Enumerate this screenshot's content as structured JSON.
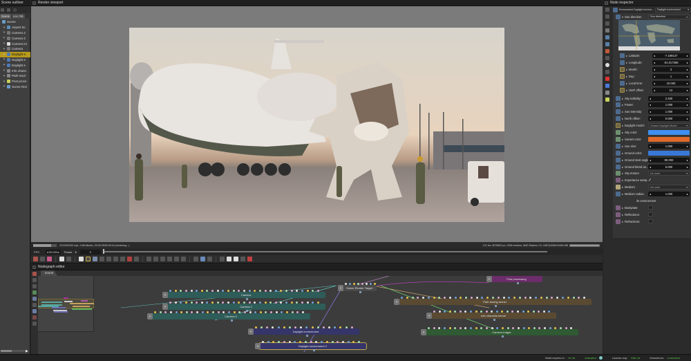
{
  "outliner": {
    "title": "Scene outliner",
    "tabs": [
      "Scene",
      "Live DB"
    ],
    "root": "Scene",
    "items": [
      {
        "label": "Airport Sc",
        "icon": "mesh-icon",
        "color": "#5d8fb8",
        "selected": false
      },
      {
        "label": "Camera 2",
        "icon": "camera-icon",
        "color": "#777777",
        "selected": false
      },
      {
        "label": "Camera 3",
        "icon": "camera-icon",
        "color": "#777777",
        "selected": false
      },
      {
        "label": "Camera im",
        "icon": "imager-icon",
        "color": "#dddddd",
        "selected": false
      },
      {
        "label": "Camera",
        "icon": "camera-icon",
        "color": "#777777",
        "selected": false
      },
      {
        "label": "Daylight e",
        "icon": "environment-icon",
        "color": "#4d7bb8",
        "selected": true
      },
      {
        "label": "Daylight e",
        "icon": "environment-icon",
        "color": "#4d7bb8",
        "selected": false
      },
      {
        "label": "Daylight e",
        "icon": "environment-icon",
        "color": "#4d7bb8",
        "selected": false
      },
      {
        "label": "Info chann",
        "icon": "kernel-icon",
        "color": "#888888",
        "selected": false
      },
      {
        "label": "Path tracir",
        "icon": "kernel-icon",
        "color": "#888888",
        "selected": false
      },
      {
        "label": "Post proce",
        "icon": "postprocess-icon",
        "color": "#c8d25a",
        "selected": false
      },
      {
        "label": "Scene Ren",
        "icon": "render-target-icon",
        "color": "#6a9cc8",
        "selected": false
      }
    ]
  },
  "viewport": {
    "title": "Render viewport",
    "status_left": "231/263/300 s/px, 4.88 Ms/sec, 00:00:39/00:00:44 (rendering...)",
    "status_right": "121 tex, 8078692 pri, 2096 meshes, AMD Radeon VII, 1867|16384/16384 MB",
    "render_progress": 0.77,
    "fps_label": "FPS",
    "fps_value": "30.000",
    "frame_mode": "Frame",
    "frame_value": "0",
    "timeline_end": "1",
    "image_alt": "Rendered airport scene with a whale-shaped aircraft, a large white mech and ground crew at sunset"
  },
  "render_toolbar": [
    "reload-icon",
    "scatter-icon",
    "color-cube-icon",
    "stop-icon",
    "restart-icon",
    "pause-icon",
    "start-icon",
    "region-render-icon",
    "pick-icon",
    "color-pick-icon",
    "material-pick-icon",
    "object-pick-icon",
    "camera-pick-icon",
    "focus-pick-icon",
    "white-balance-icon",
    "render-layer-icon",
    "clay-icon",
    "subsample-icon",
    "decal-icon",
    "viewport-lock-icon",
    "gizmo-icon",
    "copy-icon",
    "lock-icon",
    "zoom-region-icon",
    "move-icon",
    "rotate-icon",
    "scale-icon",
    "axis-icon"
  ],
  "nodegraph": {
    "title": "Nodegraph editor",
    "tab": "Scene",
    "nodes": [
      {
        "label": "Camera",
        "style": "teal"
      },
      {
        "label": "Camera 2",
        "style": "teal"
      },
      {
        "label": "Camera 3",
        "style": "teal"
      },
      {
        "label": "Scene Render Target",
        "style": "grey"
      },
      {
        "label": "Post processing",
        "style": "purple"
      },
      {
        "label": "Path tracing kernel",
        "style": "brown"
      },
      {
        "label": "Info channels kernel",
        "style": "brown"
      },
      {
        "label": "Daylight environment",
        "style": "navy"
      },
      {
        "label": "Daylight environment 2",
        "style": "navy"
      },
      {
        "label": "Camera imager",
        "style": "green"
      }
    ],
    "pin_colors": [
      "#6fa3d6",
      "#d9a7d0",
      "#e8c24a",
      "#e6e6e6",
      "#a8dcb0"
    ]
  },
  "inspector": {
    "title": "Node inspector",
    "node_type": "Environment Daylight environ...",
    "node_select": "Daylight environment",
    "sun_direction_label": "Sun direction",
    "sun_direction_select": "Sun direction",
    "params": [
      {
        "label": "Latitude:",
        "value": "-7.168137",
        "toggle": "blue",
        "kind": "number"
      },
      {
        "label": "Longitude:",
        "value": "-61.017266",
        "toggle": "blue",
        "kind": "number"
      },
      {
        "label": "Month:",
        "value": "3",
        "toggle": "gold",
        "kind": "number"
      },
      {
        "label": "Day:",
        "value": "1",
        "toggle": "gold",
        "kind": "number"
      },
      {
        "label": "Local time:",
        "value": "10.000",
        "toggle": "blue",
        "kind": "number"
      },
      {
        "label": "GMT offset:",
        "value": "12",
        "toggle": "gold",
        "kind": "number"
      }
    ],
    "params2": [
      {
        "label": "Sky turbidity:",
        "value": "2.400",
        "toggle": "blue",
        "kind": "number"
      },
      {
        "label": "Power:",
        "value": "1.000",
        "toggle": "blue",
        "kind": "number"
      },
      {
        "label": "Sun intensity:",
        "value": "1.000",
        "toggle": "blue",
        "kind": "number"
      },
      {
        "label": "North offset:",
        "value": "0.000",
        "toggle": "blue",
        "kind": "number"
      },
      {
        "label": "Daylight model:",
        "value": "Octane Daylight Model",
        "toggle": "gold",
        "kind": "select"
      },
      {
        "label": "Sky color:",
        "value": "#3f8ff0",
        "toggle": "sky",
        "kind": "color"
      },
      {
        "label": "Sunset color:",
        "value": "#e0692a",
        "toggle": "sky",
        "kind": "color"
      },
      {
        "label": "Sun size:",
        "value": "1.000",
        "toggle": "blue",
        "kind": "number"
      },
      {
        "label": "Ground color:",
        "value": "#3a78d8",
        "toggle": "blue",
        "kind": "color"
      },
      {
        "label": "Ground start angle:",
        "value": "90.000",
        "toggle": "blue",
        "kind": "number"
      },
      {
        "label": "Ground blend an...",
        "value": "5.000",
        "toggle": "blue",
        "kind": "number"
      },
      {
        "label": "Sky texture",
        "value": "No node",
        "toggle": "sky",
        "kind": "select"
      },
      {
        "label": "Importance samp...",
        "value": "checked",
        "toggle": "pink",
        "kind": "check"
      },
      {
        "label": "Medium",
        "value": "No node",
        "toggle": "khaki",
        "kind": "select"
      },
      {
        "label": "Medium radius:",
        "value": "1.000",
        "toggle": "blue",
        "kind": "number"
      }
    ],
    "section": "ile environment",
    "visibility": [
      {
        "label": "Backplate:",
        "toggle": "pink"
      },
      {
        "label": "Reflections:",
        "toggle": "pink"
      },
      {
        "label": "Refractions:",
        "toggle": "pink"
      }
    ]
  },
  "statusbar": {
    "build_label": "Build expires in:",
    "build_value": "7w 4d",
    "activated": "Activated",
    "license_label": "License exp.:",
    "license_value": "93w 1d",
    "octanelive_label": "OctaneLive:",
    "octanelive_value": "connected"
  }
}
